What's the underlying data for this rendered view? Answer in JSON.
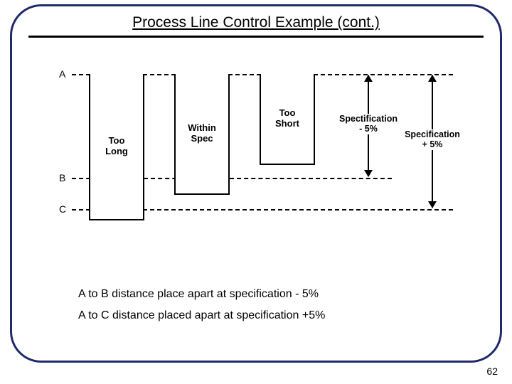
{
  "slide": {
    "title": "Process Line Control Example (cont.)",
    "page_number": "62"
  },
  "diagram": {
    "levels": {
      "A": "A",
      "B": "B",
      "C": "C"
    },
    "bars": [
      {
        "line1": "Too",
        "line2": "Long"
      },
      {
        "line1": "Within",
        "line2": "Spec"
      },
      {
        "line1": "Too",
        "line2": "Short"
      }
    ],
    "arrows": {
      "ab": {
        "line1": "Spectification",
        "line2": "- 5%"
      },
      "ac": {
        "line1": "Specification",
        "line2": "+ 5%"
      }
    }
  },
  "notes": {
    "line1": "A to B distance place apart at specification - 5%",
    "line2": "A to C distance placed apart at specification +5%"
  },
  "chart_data": {
    "type": "bar",
    "levels": [
      "A",
      "B",
      "C"
    ],
    "categories": [
      "Too Long",
      "Within Spec",
      "Too Short"
    ],
    "bar_bottom_level": [
      "below C",
      "between B and C",
      "just below B"
    ],
    "annotations": [
      {
        "span": "A to B",
        "label": "Spectification - 5%"
      },
      {
        "span": "A to C",
        "label": "Specification + 5%"
      }
    ],
    "title": "Process Line Control Example (cont.)"
  }
}
